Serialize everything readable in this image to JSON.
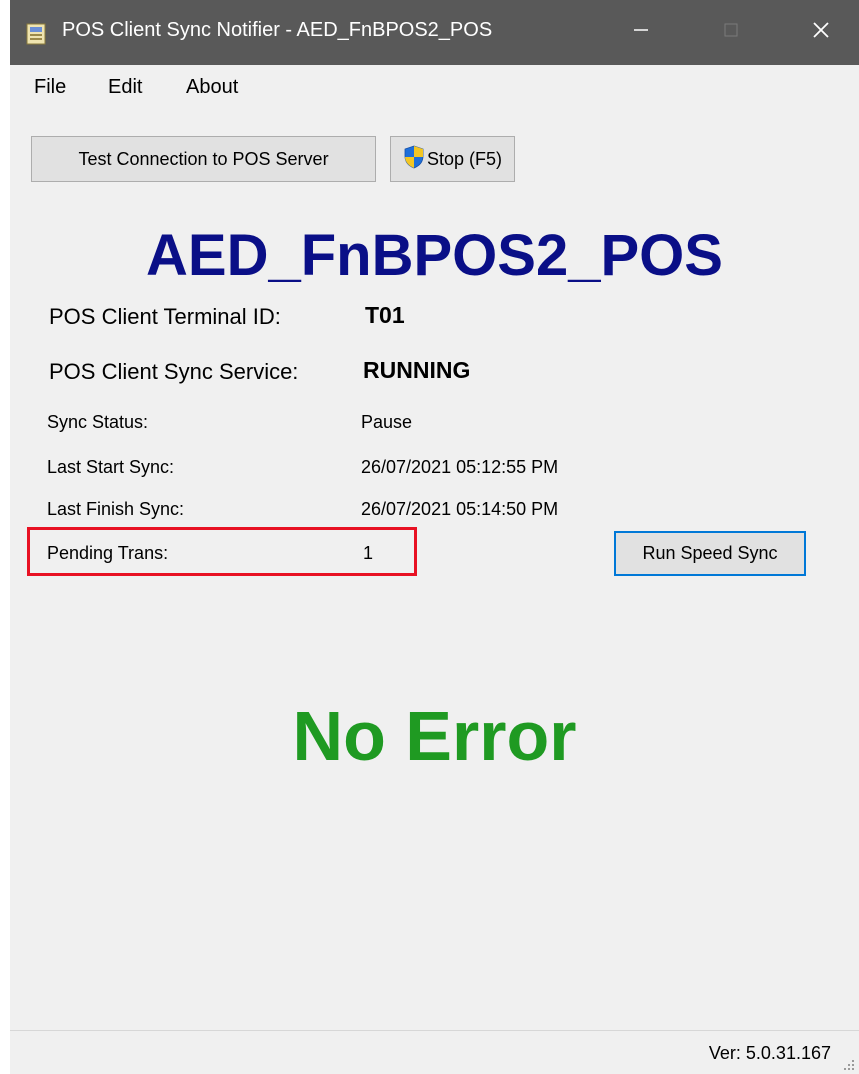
{
  "window": {
    "title": "POS Client Sync Notifier - AED_FnBPOS2_POS"
  },
  "menu": {
    "file": "File",
    "edit": "Edit",
    "about": "About"
  },
  "toolbar": {
    "test_connection": "Test Connection to POS Server",
    "stop": "Stop (F5)"
  },
  "header": {
    "pos_name": "AED_FnBPOS2_POS"
  },
  "info": {
    "terminal_id_label": "POS Client Terminal ID:",
    "terminal_id_value": "T01",
    "service_label": "POS Client Sync Service:",
    "service_value": "RUNNING",
    "sync_status_label": "Sync Status:",
    "sync_status_value": "Pause",
    "last_start_label": "Last Start Sync:",
    "last_start_value": "26/07/2021 05:12:55 PM",
    "last_finish_label": "Last Finish Sync:",
    "last_finish_value": "26/07/2021 05:14:50 PM",
    "pending_label": "Pending Trans:",
    "pending_value": "1"
  },
  "actions": {
    "run_speed_sync": "Run Speed Sync"
  },
  "status": {
    "message": "No Error",
    "version": "Ver: 5.0.31.167"
  },
  "colors": {
    "pos_name": "#0a0f87",
    "status_ok": "#1f9a22",
    "highlight_red": "#e81123",
    "focus_blue": "#0078d7",
    "titlebar": "#595959"
  }
}
